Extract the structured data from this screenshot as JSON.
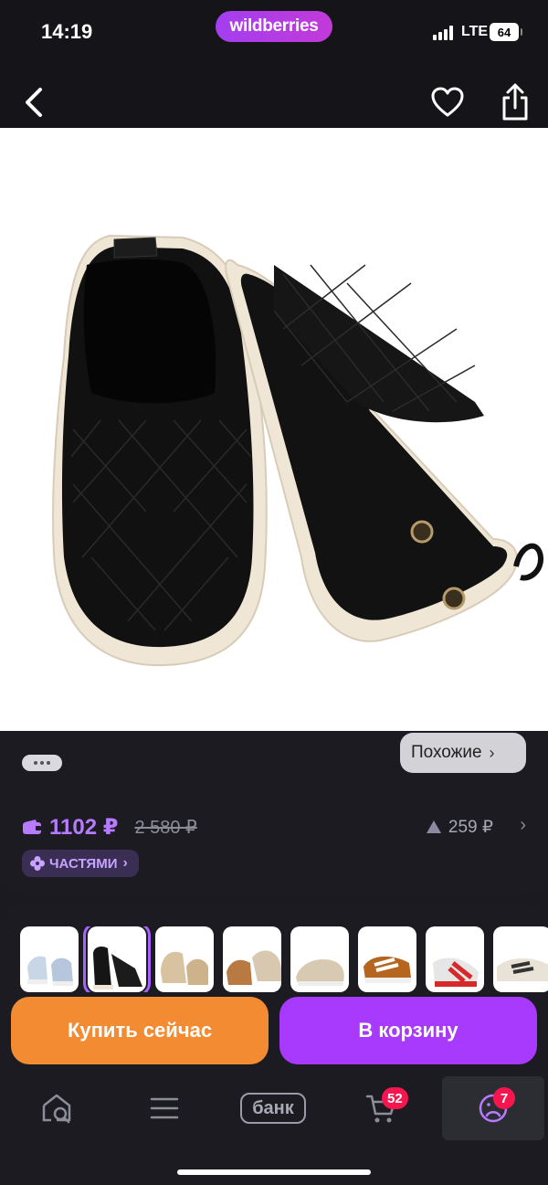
{
  "status_bar": {
    "time": "14:19",
    "brand": "wildberries",
    "network": "LTE",
    "battery": "64"
  },
  "nav": {
    "back_icon": "chevron-left-icon",
    "favorite_icon": "heart-icon",
    "share_icon": "share-icon"
  },
  "product": {
    "image_icon": "black-baby-slip-on-shoes"
  },
  "info": {
    "similar_label": "Похожие",
    "price": "1102 ₽",
    "old_price": "2 580 ₽",
    "price_delta": "259 ₽",
    "installments_label": "ЧАСТЯМИ"
  },
  "variants": {
    "count": 8,
    "selected_index": 1
  },
  "actions": {
    "buy_now": "Купить сейчас",
    "add_to_cart": "В корзину"
  },
  "tabbar": {
    "bank_label": "банк",
    "cart_badge": "52",
    "profile_badge": "7"
  },
  "colors": {
    "accent": "#a73afd",
    "buy": "#f28b32",
    "price": "#b77bff",
    "badge": "#f5164f"
  }
}
